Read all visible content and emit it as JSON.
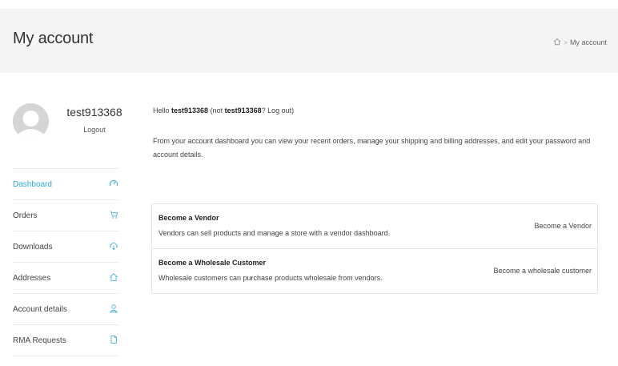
{
  "header": {
    "title": "My account",
    "breadcrumb_current": "My account"
  },
  "user": {
    "name": "test913368",
    "logout_label": "Logout"
  },
  "nav": {
    "items": [
      {
        "label": "Dashboard",
        "icon": "gauge-icon",
        "active": true
      },
      {
        "label": "Orders",
        "icon": "cart-icon"
      },
      {
        "label": "Downloads",
        "icon": "cloud-download-icon"
      },
      {
        "label": "Addresses",
        "icon": "home-icon"
      },
      {
        "label": "Account details",
        "icon": "user-icon"
      },
      {
        "label": "RMA Requests",
        "icon": "document-icon"
      }
    ],
    "accent_color": "#2fa8d8"
  },
  "main": {
    "hello_prefix": "Hello ",
    "hello_user": "test913368",
    "hello_mid": " (not ",
    "hello_user2": "test913368",
    "hello_q": "? ",
    "hello_logout": "Log out",
    "hello_end": ")",
    "intro": "From your account dashboard you can view your recent orders, manage your shipping and billing addresses, and edit your password and account details."
  },
  "vendor_rows": [
    {
      "title": "Become a Vendor",
      "desc": "Vendors can sell products and manage a store with a vendor dashboard.",
      "action": "Become a Vendor"
    },
    {
      "title": "Become a Wholesale Customer",
      "desc": "Wholesale customers can purchase products wholesale from vendors.",
      "action": "Become a wholesale customer"
    }
  ]
}
